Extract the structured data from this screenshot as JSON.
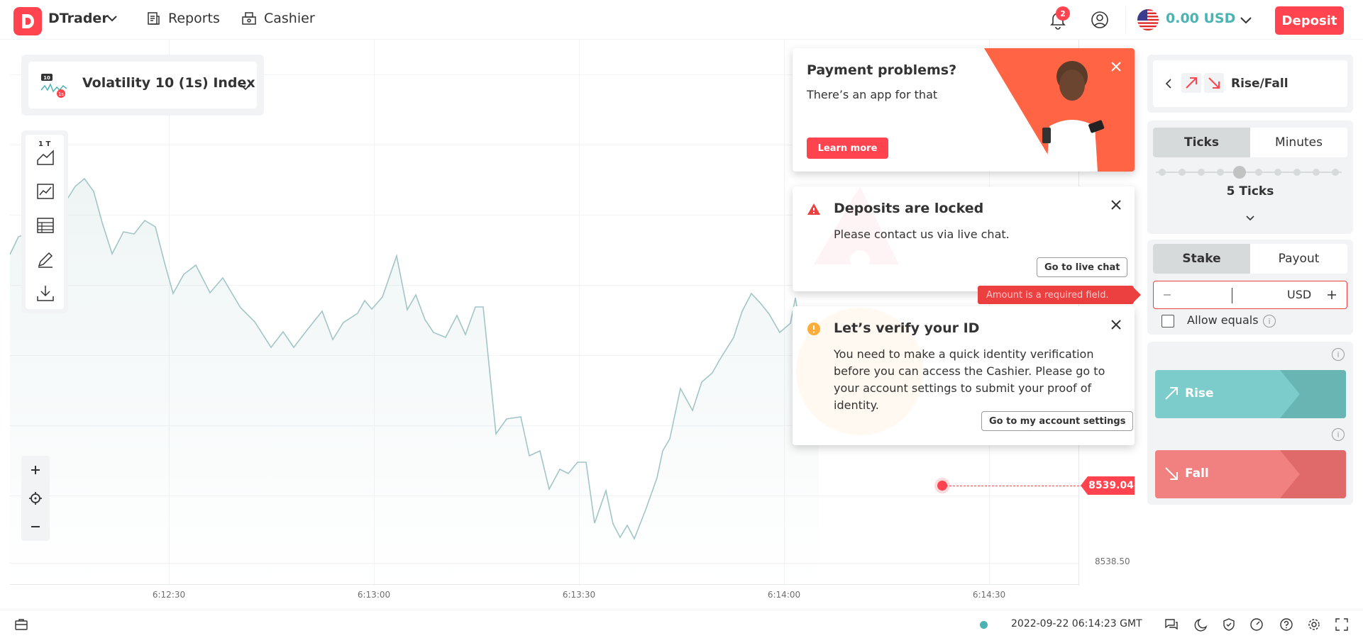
{
  "header": {
    "app_name": "DTrader",
    "nav": [
      {
        "label": "Reports",
        "icon": "reports-icon"
      },
      {
        "label": "Cashier",
        "icon": "cashier-icon"
      }
    ],
    "notification_count": "2",
    "balance": "0.00 USD",
    "deposit_label": "Deposit",
    "accent": "#ff444f",
    "balance_color": "#4bb4b3"
  },
  "symbol": {
    "name": "Volatility 10 (1s) Index"
  },
  "toolbar": {
    "tick_label": "1 T"
  },
  "chart": {
    "x_ticks": [
      "6:12:30",
      "6:13:00",
      "6:13:30",
      "6:14:00",
      "6:14:30"
    ],
    "y_ticks": [
      "8538.50"
    ],
    "current_price": "8539.04",
    "line_color": "#a2c5c6"
  },
  "notifications": {
    "payment": {
      "title": "Payment problems?",
      "text": "There’s an app for that",
      "button": "Learn more"
    },
    "deposits": {
      "title": "Deposits are locked",
      "text": "Please contact us via live chat.",
      "button": "Go to live chat"
    },
    "verify": {
      "title": "Let’s verify your ID",
      "text": "You need to make a quick identity verification before you can access the Cashier. Please go to your account settings to submit your proof of identity.",
      "button": "Go to my account settings"
    },
    "error_tooltip": "Amount is a required field."
  },
  "trade": {
    "contract_type": "Rise/Fall",
    "duration_tabs": [
      "Ticks",
      "Minutes"
    ],
    "duration_value": "5 Ticks",
    "amount_tabs": [
      "Stake",
      "Payout"
    ],
    "currency": "USD",
    "allow_equals": "Allow equals",
    "rise_label": "Rise",
    "fall_label": "Fall",
    "rise_color": "#7bcccb",
    "fall_color": "#f18080"
  },
  "footer": {
    "server_time": "2022-09-22 06:14:23 GMT"
  }
}
